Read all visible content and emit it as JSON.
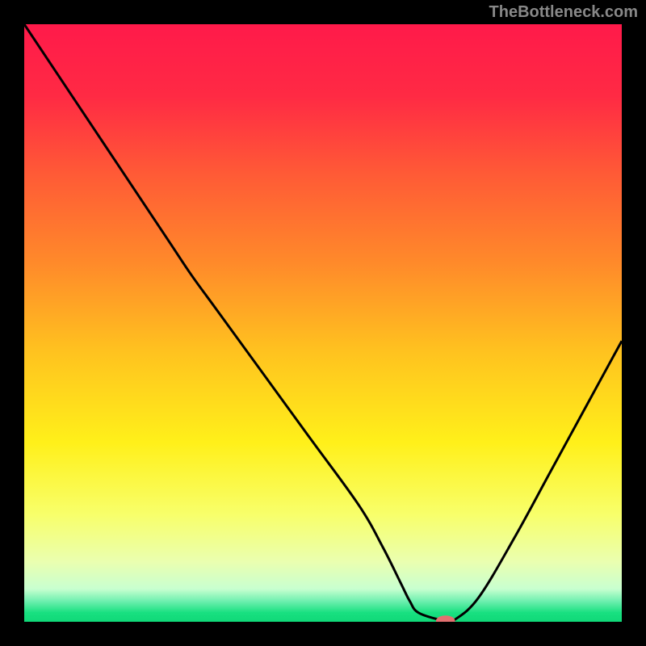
{
  "watermark": "TheBottleneck.com",
  "chart_data": {
    "type": "line",
    "title": "",
    "xlabel": "",
    "ylabel": "",
    "xlim": [
      0,
      100
    ],
    "ylim": [
      0,
      100
    ],
    "background_gradient": {
      "stops": [
        {
          "offset": 0.0,
          "color": "#ff1a4a"
        },
        {
          "offset": 0.12,
          "color": "#ff2a44"
        },
        {
          "offset": 0.25,
          "color": "#ff5a36"
        },
        {
          "offset": 0.4,
          "color": "#ff8a2a"
        },
        {
          "offset": 0.55,
          "color": "#ffc31f"
        },
        {
          "offset": 0.7,
          "color": "#fff01a"
        },
        {
          "offset": 0.82,
          "color": "#f8ff6a"
        },
        {
          "offset": 0.9,
          "color": "#eaffb0"
        },
        {
          "offset": 0.945,
          "color": "#c8ffd0"
        },
        {
          "offset": 0.965,
          "color": "#70f0b0"
        },
        {
          "offset": 0.985,
          "color": "#18e080"
        },
        {
          "offset": 1.0,
          "color": "#10d878"
        }
      ]
    },
    "series": [
      {
        "name": "bottleneck-curve",
        "color": "#000000",
        "x": [
          0.0,
          8,
          16,
          24,
          28,
          32,
          40,
          48,
          56,
          60,
          63,
          64.5,
          66,
          70,
          71,
          72,
          76,
          82,
          88,
          94,
          100
        ],
        "y": [
          100,
          88,
          76,
          64,
          58,
          52.5,
          41.5,
          30.5,
          19.5,
          12.5,
          6.5,
          3.5,
          1.5,
          0.2,
          0.1,
          0.3,
          4,
          14,
          25,
          36,
          47
        ]
      }
    ],
    "marker": {
      "name": "optimal-point",
      "x": 70.5,
      "y": 0.15,
      "color": "#e27070",
      "rx": 1.6,
      "ry": 0.9
    }
  }
}
